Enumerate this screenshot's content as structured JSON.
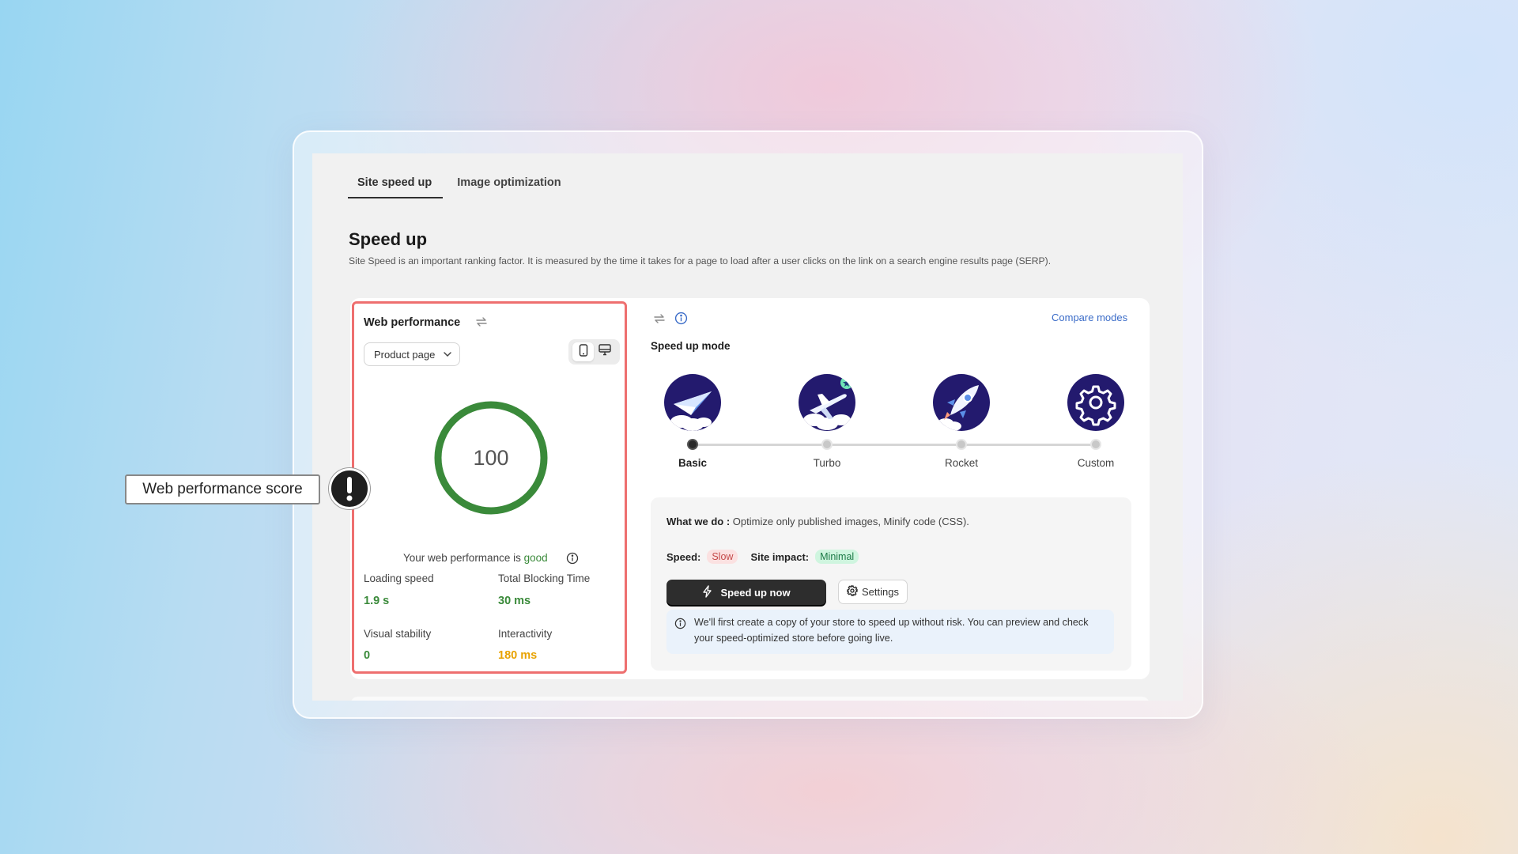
{
  "tabs": [
    {
      "label": "Site speed up",
      "active": true
    },
    {
      "label": "Image optimization",
      "active": false
    }
  ],
  "page": {
    "title": "Speed up",
    "subtitle": "Site Speed is an important ranking factor. It is measured by the time it takes for a page to load after a user clicks on the link on a search engine results page (SERP)."
  },
  "web_performance": {
    "title": "Web performance",
    "refresh_icon": "refresh-icon",
    "page_select": "Product page",
    "device_options": [
      "mobile",
      "desktop"
    ],
    "selected_device": "mobile",
    "score": "100",
    "score_fraction": 1.0,
    "summary_prefix": "Your web performance is",
    "summary_status": "good",
    "metrics": [
      {
        "label": "Loading speed",
        "value": "1.9 s",
        "status": "good"
      },
      {
        "label": "Total Blocking Time",
        "value": "30 ms",
        "status": "good"
      },
      {
        "label": "Visual stability",
        "value": "0",
        "status": "good"
      },
      {
        "label": "Interactivity",
        "value": "180 ms",
        "status": "warning"
      }
    ]
  },
  "speed_mode": {
    "compare_link": "Compare modes",
    "title": "Speed up mode",
    "modes": [
      {
        "label": "Basic",
        "icon": "paper-plane-icon",
        "selected": true
      },
      {
        "label": "Turbo",
        "icon": "airplane-icon",
        "selected": false
      },
      {
        "label": "Rocket",
        "icon": "rocket-icon",
        "selected": false
      },
      {
        "label": "Custom",
        "icon": "gear-icon",
        "selected": false
      }
    ],
    "what_we_do_label": "What we do :",
    "what_we_do_text": "Optimize only published images, Minify code (CSS).",
    "speed_label": "Speed:",
    "speed_value": "Slow",
    "impact_label": "Site impact:",
    "impact_value": "Minimal",
    "primary_button": "Speed up now",
    "settings_button": "Settings",
    "note": "We'll first create a copy of your store to speed up without risk. You can preview and check your speed-optimized store before going live."
  },
  "callout": {
    "label": "Web performance score",
    "icon": "exclamation-icon"
  },
  "colors": {
    "good": "#3a8a3a",
    "warning": "#e8a200",
    "highlight_border": "#ee6f6f",
    "mode_icon_bg": "#231a6e",
    "link": "#3b6cc8"
  }
}
